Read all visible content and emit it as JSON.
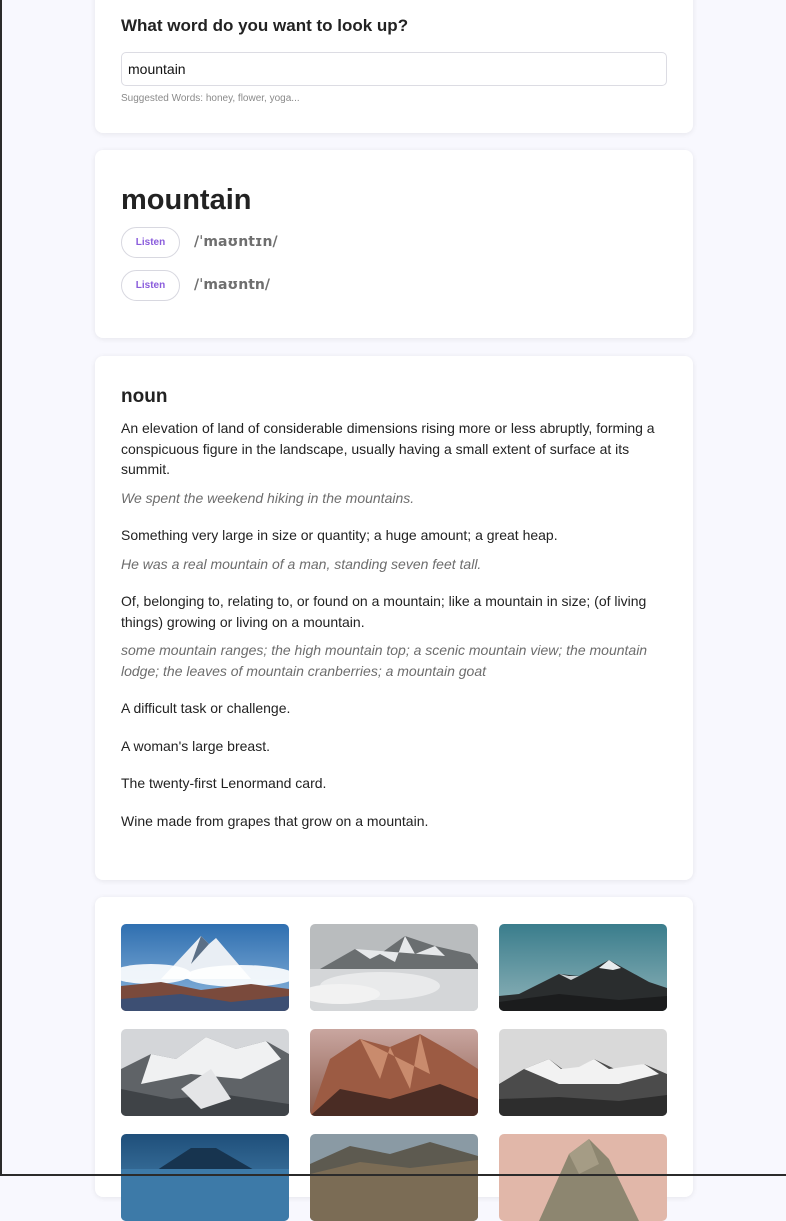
{
  "search": {
    "title": "What word do you want to look up?",
    "value": "mountain",
    "suggestions": "Suggested Words: honey, flower, yoga..."
  },
  "word": {
    "title": "mountain",
    "pronunciations": [
      {
        "button": "Listen",
        "phonetic": "/ˈmaʊntɪn/"
      },
      {
        "button": "Listen",
        "phonetic": "/ˈmaʊntn/"
      }
    ]
  },
  "meaning": {
    "part_of_speech": "noun",
    "definitions": [
      {
        "text": "An elevation of land of considerable dimensions rising more or less abruptly, forming a conspicuous figure in the landscape, usually having a small extent of surface at its summit.",
        "example": "We spent the weekend hiking in the mountains."
      },
      {
        "text": "Something very large in size or quantity; a huge amount; a great heap.",
        "example": "He was a real mountain of a man, standing seven feet tall."
      },
      {
        "text": "Of, belonging to, relating to, or found on a mountain; like a mountain in size; (of living things) growing or living on a mountain.",
        "example": "some mountain ranges; the high mountain top; a scenic mountain view; the mountain lodge; the leaves of mountain cranberries; a mountain goat"
      },
      {
        "text": "A difficult task or challenge."
      },
      {
        "text": "A woman's large breast."
      },
      {
        "text": "The twenty-first Lenormand card."
      },
      {
        "text": "Wine made from grapes that grow on a mountain."
      }
    ]
  },
  "images": [
    {
      "name": "snowy-peak-clouds-photo"
    },
    {
      "name": "misty-ridge-photo"
    },
    {
      "name": "dark-peak-teal-sky-photo"
    },
    {
      "name": "snow-range-aerial-photo"
    },
    {
      "name": "red-rock-mountain-photo"
    },
    {
      "name": "grey-snow-range-photo"
    },
    {
      "name": "blue-lake-volcano-photo"
    },
    {
      "name": "valley-hills-photo"
    },
    {
      "name": "rock-spire-photo"
    }
  ],
  "colors": {
    "accent": "#8a5cdc",
    "background": "#f8f8fe"
  }
}
